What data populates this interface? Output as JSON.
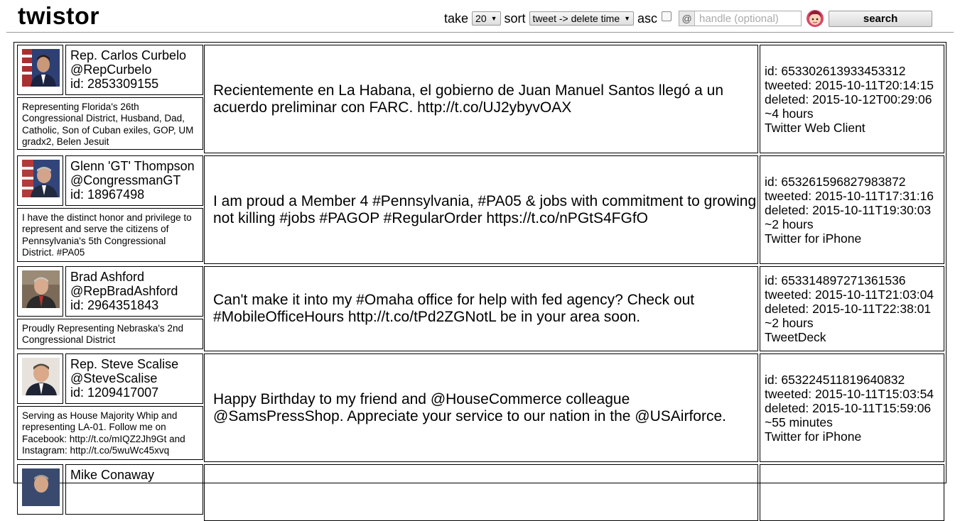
{
  "app": {
    "title": "twistor"
  },
  "controls": {
    "take_label": "take",
    "take_value": "20",
    "sort_label": "sort",
    "sort_value": "tweet -> delete time",
    "asc_label": "asc",
    "asc_checked": false,
    "handle_prefix": "@",
    "handle_placeholder": "handle (optional)",
    "search_label": "search"
  },
  "colors": {
    "border": "#000000",
    "divider": "#999999"
  },
  "rows": [
    {
      "name": "Rep. Carlos Curbelo",
      "handle": "@RepCurbelo",
      "user_id": "id: 2853309155",
      "bio": "Representing Florida's 26th Congressional District, Husband, Dad, Catholic, Son of Cuban exiles, GOP, UM gradx2, Belen Jesuit",
      "tweet": "Recientemente en La Habana, el gobierno de Juan Manuel Santos llegó a un acuerdo preliminar con FARC. http://t.co/UJ2ybyvOAX",
      "tweet_id": "id: 653302613933453312",
      "tweeted": "tweeted: 2015-10-11T20:14:15",
      "deleted": "deleted: 2015-10-12T00:29:06",
      "duration": "~4 hours",
      "client": "Twitter Web Client"
    },
    {
      "name": "Glenn 'GT' Thompson",
      "handle": "@CongressmanGT",
      "user_id": "id: 18967498",
      "bio": "I have the distinct honor and privilege to represent and serve the citizens of Pennsylvania's 5th Congressional District. #PA05",
      "tweet": "I am proud a Member 4 #Pennsylvania, #PA05 & jobs with commitment to growing not killing #jobs #PAGOP #RegularOrder https://t.co/nPGtS4FGfO",
      "tweet_id": "id: 653261596827983872",
      "tweeted": "tweeted: 2015-10-11T17:31:16",
      "deleted": "deleted: 2015-10-11T19:30:03",
      "duration": "~2 hours",
      "client": "Twitter for iPhone"
    },
    {
      "name": "Brad Ashford",
      "handle": "@RepBradAshford",
      "user_id": "id: 2964351843",
      "bio": "Proudly Representing Nebraska's 2nd Congressional District",
      "tweet": "Can't make it into my #Omaha office for help with fed agency? Check out #MobileOfficeHours http://t.co/tPd2ZGNotL be in your area soon.",
      "tweet_id": "id: 653314897271361536",
      "tweeted": "tweeted: 2015-10-11T21:03:04",
      "deleted": "deleted: 2015-10-11T22:38:01",
      "duration": "~2 hours",
      "client": "TweetDeck"
    },
    {
      "name": "Rep. Steve Scalise",
      "handle": "@SteveScalise",
      "user_id": "id: 1209417007",
      "bio": "Serving as House Majority Whip and representing LA-01. Follow me on Facebook: http://t.co/mIQZ2Jh9Gt and Instagram: http://t.co/5wuWc45xvq",
      "tweet": "Happy Birthday to my friend and @HouseCommerce colleague @SamsPressShop. Appreciate your service to our nation in the @USAirforce.",
      "tweet_id": "id: 653224511819640832",
      "tweeted": "tweeted: 2015-10-11T15:03:54",
      "deleted": "deleted: 2015-10-11T15:59:06",
      "duration": "~55 minutes",
      "client": "Twitter for iPhone"
    },
    {
      "name": "Mike Conaway",
      "handle": "",
      "user_id": "",
      "bio": "",
      "tweet": "",
      "tweet_id": "",
      "tweeted": "",
      "deleted": "",
      "duration": "",
      "client": ""
    }
  ]
}
